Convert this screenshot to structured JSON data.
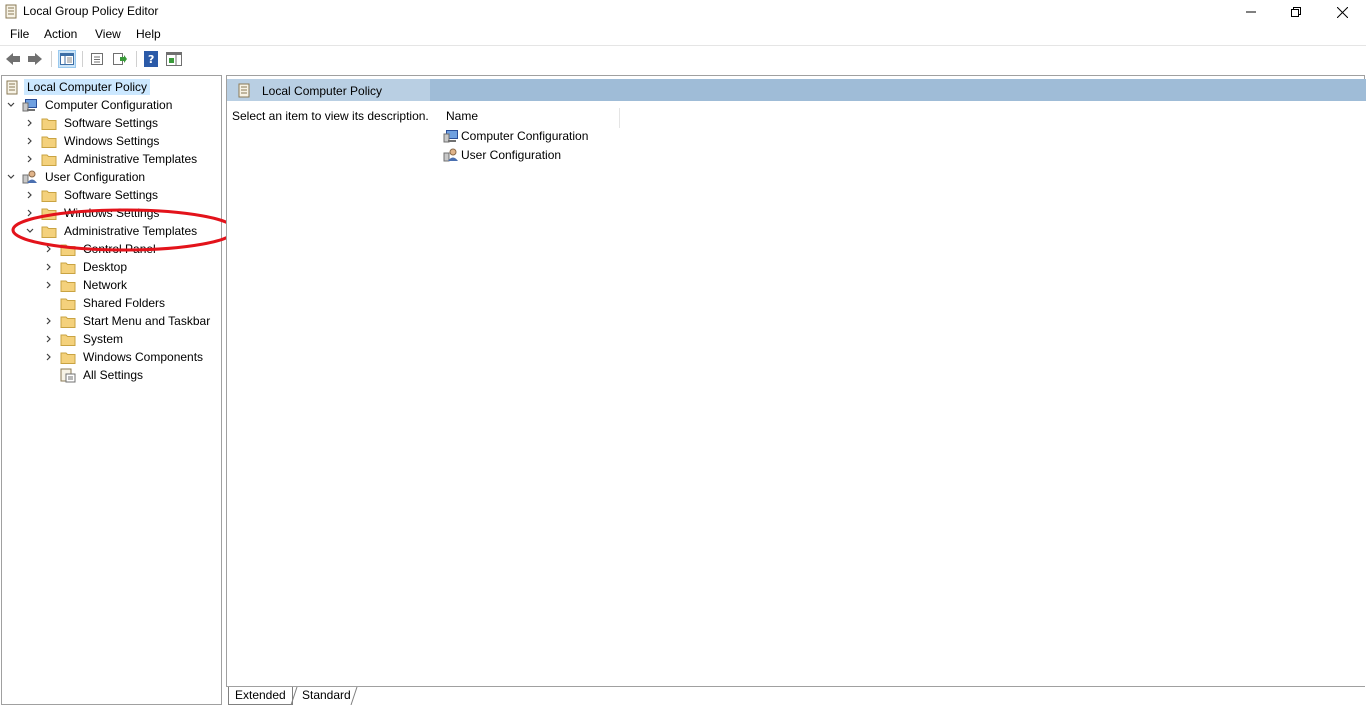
{
  "window": {
    "title": "Local Group Policy Editor"
  },
  "menubar": {
    "items": [
      "File",
      "Action",
      "View",
      "Help"
    ]
  },
  "toolbar": {
    "buttons": [
      "back-icon",
      "forward-icon",
      "show-hide-console-tree-icon",
      "properties-icon",
      "export-list-icon",
      "help-icon",
      "action-pane-icon"
    ]
  },
  "tree": {
    "items": [
      {
        "label": "Local Computer Policy",
        "icon": "policy-scroll-icon",
        "selected": true
      },
      {
        "label": "Computer Configuration",
        "icon": "computer-icon",
        "expanded": true
      },
      {
        "label": "Software Settings",
        "icon": "folder-icon"
      },
      {
        "label": "Windows Settings",
        "icon": "folder-icon"
      },
      {
        "label": "Administrative Templates",
        "icon": "folder-icon"
      },
      {
        "label": "User Configuration",
        "icon": "user-icon",
        "expanded": true
      },
      {
        "label": "Software Settings",
        "icon": "folder-icon"
      },
      {
        "label": "Windows Settings",
        "icon": "folder-icon"
      },
      {
        "label": "Administrative Templates",
        "icon": "folder-icon",
        "expanded": true
      },
      {
        "label": "Control Panel",
        "icon": "folder-icon"
      },
      {
        "label": "Desktop",
        "icon": "folder-icon"
      },
      {
        "label": "Network",
        "icon": "folder-icon"
      },
      {
        "label": "Shared Folders",
        "icon": "folder-icon"
      },
      {
        "label": "Start Menu and Taskbar",
        "icon": "folder-icon"
      },
      {
        "label": "System",
        "icon": "folder-icon"
      },
      {
        "label": "Windows Components",
        "icon": "folder-icon"
      },
      {
        "label": "All Settings",
        "icon": "all-settings-icon"
      }
    ]
  },
  "main": {
    "header_title": "Local Computer Policy",
    "description": "Select an item to view its description.",
    "column_name": "Name",
    "items": [
      {
        "label": "Computer Configuration",
        "icon": "computer-icon"
      },
      {
        "label": "User Configuration",
        "icon": "user-icon"
      }
    ]
  },
  "tabs": {
    "extended": "Extended",
    "standard": "Standard"
  },
  "colors": {
    "header_bar": "#9fbcd7",
    "selection": "#cce8ff",
    "annotation": "#e3131b",
    "folder": "#f4d17c"
  }
}
